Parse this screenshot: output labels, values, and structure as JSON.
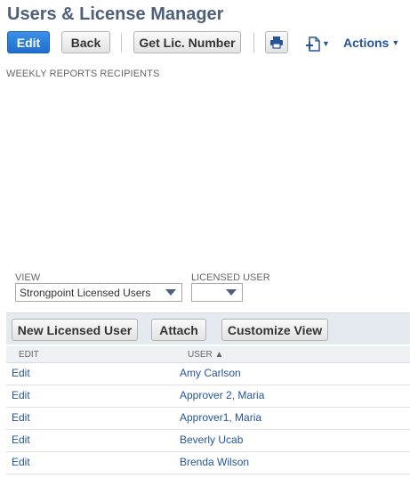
{
  "page": {
    "title": "Users & License Manager"
  },
  "toolbar": {
    "edit_label": "Edit",
    "back_label": "Back",
    "getlic_label": "Get Lic. Number",
    "actions_label": "Actions"
  },
  "section": {
    "label": "WEEKLY REPORTS RECIPIENTS"
  },
  "filters": {
    "view_label": "VIEW",
    "view_value": "Strongpoint Licensed Users",
    "licensed_label": "LICENSED USER",
    "licensed_value": ""
  },
  "list": {
    "new_label": "New Licensed User",
    "attach_label": "Attach",
    "customize_label": "Customize View",
    "columns": {
      "edit": "EDIT",
      "user": "USER ▲"
    },
    "rows": [
      {
        "edit": "Edit",
        "user": "Amy Carlson"
      },
      {
        "edit": "Edit",
        "user": "Approver 2, Maria"
      },
      {
        "edit": "Edit",
        "user": "Approver1, Maria"
      },
      {
        "edit": "Edit",
        "user": "Beverly Ucab"
      },
      {
        "edit": "Edit",
        "user": "Brenda Wilson"
      }
    ]
  },
  "colors": {
    "title": "#4d5f79",
    "primary": "#2a7de1",
    "link": "#255599",
    "bar": "#e5e9f0"
  },
  "icons": {
    "print": "print-icon",
    "add_file": "add-file-icon",
    "dropdown": "chevron-down-icon"
  }
}
